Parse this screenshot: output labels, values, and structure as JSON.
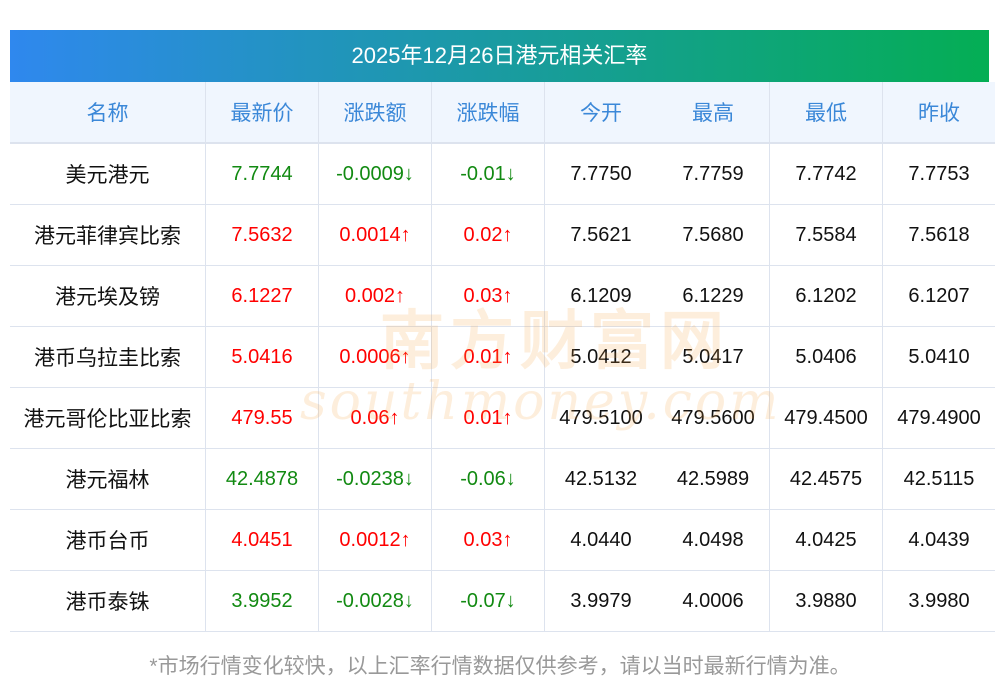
{
  "title": "2025年12月26日港元相关汇率",
  "columns": [
    "名称",
    "最新价",
    "涨跌额",
    "涨跌幅",
    "今开",
    "最高",
    "最低",
    "昨收"
  ],
  "rows": [
    {
      "name": "美元港元",
      "latest": "7.7744",
      "change": "-0.0009↓",
      "pct": "-0.01↓",
      "dir": "down",
      "open": "7.7750",
      "high": "7.7759",
      "low": "7.7742",
      "prev": "7.7753"
    },
    {
      "name": "港元菲律宾比索",
      "latest": "7.5632",
      "change": "0.0014↑",
      "pct": "0.02↑",
      "dir": "up",
      "open": "7.5621",
      "high": "7.5680",
      "low": "7.5584",
      "prev": "7.5618"
    },
    {
      "name": "港元埃及镑",
      "latest": "6.1227",
      "change": "0.002↑",
      "pct": "0.03↑",
      "dir": "up",
      "open": "6.1209",
      "high": "6.1229",
      "low": "6.1202",
      "prev": "6.1207"
    },
    {
      "name": "港币乌拉圭比索",
      "latest": "5.0416",
      "change": "0.0006↑",
      "pct": "0.01↑",
      "dir": "up",
      "open": "5.0412",
      "high": "5.0417",
      "low": "5.0406",
      "prev": "5.0410"
    },
    {
      "name": "港元哥伦比亚比索",
      "latest": "479.55",
      "change": "0.06↑",
      "pct": "0.01↑",
      "dir": "up",
      "open": "479.5100",
      "high": "479.5600",
      "low": "479.4500",
      "prev": "479.4900"
    },
    {
      "name": "港元福林",
      "latest": "42.4878",
      "change": "-0.0238↓",
      "pct": "-0.06↓",
      "dir": "down",
      "open": "42.5132",
      "high": "42.5989",
      "low": "42.4575",
      "prev": "42.5115"
    },
    {
      "name": "港币台币",
      "latest": "4.0451",
      "change": "0.0012↑",
      "pct": "0.03↑",
      "dir": "up",
      "open": "4.0440",
      "high": "4.0498",
      "low": "4.0425",
      "prev": "4.0439"
    },
    {
      "name": "港币泰铢",
      "latest": "3.9952",
      "change": "-0.0028↓",
      "pct": "-0.07↓",
      "dir": "down",
      "open": "3.9979",
      "high": "4.0006",
      "low": "3.9880",
      "prev": "3.9980"
    }
  ],
  "footer": "*市场行情变化较快，以上汇率行情数据仅供参考，请以当时最新行情为准。",
  "watermark": {
    "cn": "南方财富网",
    "en": "southmoney.com"
  },
  "colors": {
    "up": "#ff0000",
    "down": "#128a12",
    "header_text": "#3b88d8"
  }
}
